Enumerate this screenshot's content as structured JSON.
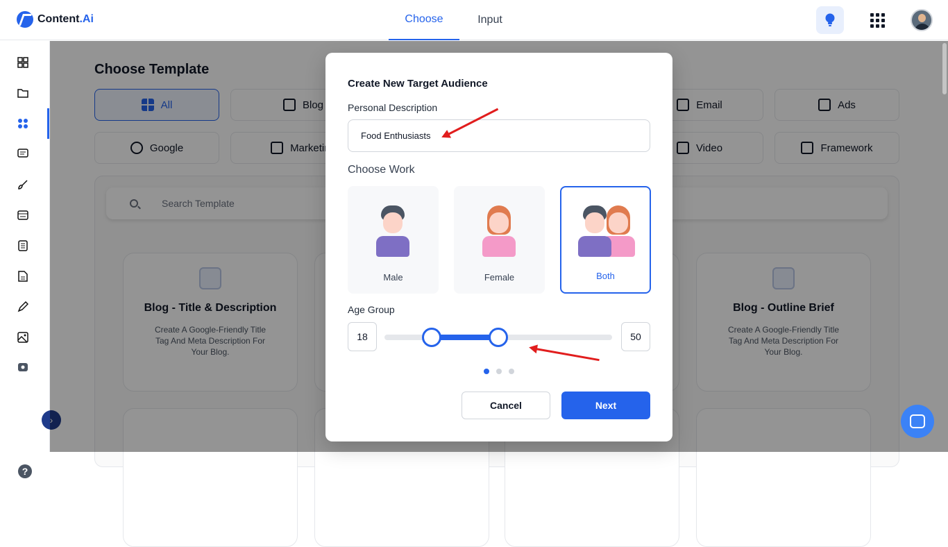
{
  "app": {
    "brand": "Content",
    "brand_accent": ".Ai"
  },
  "top_tabs": [
    {
      "label": "Choose"
    },
    {
      "label": "Input"
    }
  ],
  "page": {
    "title": "Choose Template"
  },
  "categories": [
    {
      "label": "All"
    },
    {
      "label": "Blog"
    },
    {
      "label": "Email"
    },
    {
      "label": "Ads"
    },
    {
      "label": "Google"
    },
    {
      "label": "Marketing"
    },
    {
      "label": "Video"
    },
    {
      "label": "Framework"
    }
  ],
  "search": {
    "placeholder": "Search Template"
  },
  "cards": [
    {
      "title": "Blog - Title & Description",
      "description": "Create A Google-Friendly Title Tag And Meta Description For Your Blog."
    },
    {
      "title": "Blog - Outline Brief",
      "description": "Create A Google-Friendly Title Tag And Meta Description For Your Blog."
    }
  ],
  "modal": {
    "title": "Create New Target Audience",
    "personal_description_label": "Personal Description",
    "personal_description_value": "Food Enthusiasts",
    "choose_work_label": "Choose Work",
    "options": [
      {
        "label": "Male"
      },
      {
        "label": "Female"
      },
      {
        "label": "Both"
      }
    ],
    "selected_option": "Both",
    "age_group_label": "Age Group",
    "age_min": "18",
    "age_max": "50",
    "step": 1,
    "step_count": 3,
    "cancel_label": "Cancel",
    "next_label": "Next"
  },
  "colors": {
    "accent": "#2563eb",
    "annotation": "#e11d1d"
  }
}
